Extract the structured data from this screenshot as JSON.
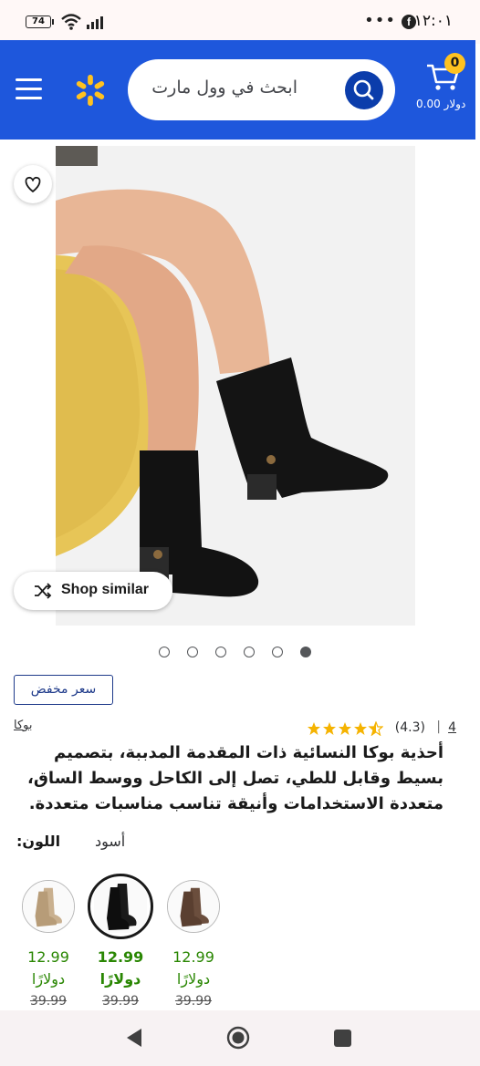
{
  "status_bar": {
    "battery": "74",
    "time": "١٢:٠١"
  },
  "header": {
    "search_placeholder": "ابحث في وول مارت",
    "cart_count": "0",
    "cart_total": "0.00 دولار"
  },
  "colors": {
    "header_bg": "#1e57dc",
    "spark": "#ffc220",
    "search_button": "#0b3dab",
    "price_green": "#2a8703",
    "rollback_blue": "#1e3a8a"
  },
  "product": {
    "shop_similar_label": "Shop similar",
    "image_count": 6,
    "active_image": 6,
    "badge": "سعر مخفض",
    "brand": "بوكا",
    "rating_value": "(4.3)",
    "rating_stars": 4.3,
    "review_count": "4",
    "title": "أحذية بوكا النسائية ذات المقدمة المدببة، بتصميم بسيط وقابل للطي، تصل إلى الكاحل ووسط الساق، متعددة الاستخدامات وأنيقة تناسب مناسبات متعددة.",
    "color_label": "اللون:",
    "color_value": "أسود",
    "variants": [
      {
        "name": "beige",
        "price": "12.99",
        "currency": "دولارًا",
        "old_price": "39.99",
        "selected": false
      },
      {
        "name": "black",
        "price": "12.99",
        "currency": "دولارًا",
        "old_price": "39.99",
        "selected": true
      },
      {
        "name": "brown",
        "price": "12.99",
        "currency": "دولارًا",
        "old_price": "39.99",
        "selected": false
      }
    ]
  }
}
